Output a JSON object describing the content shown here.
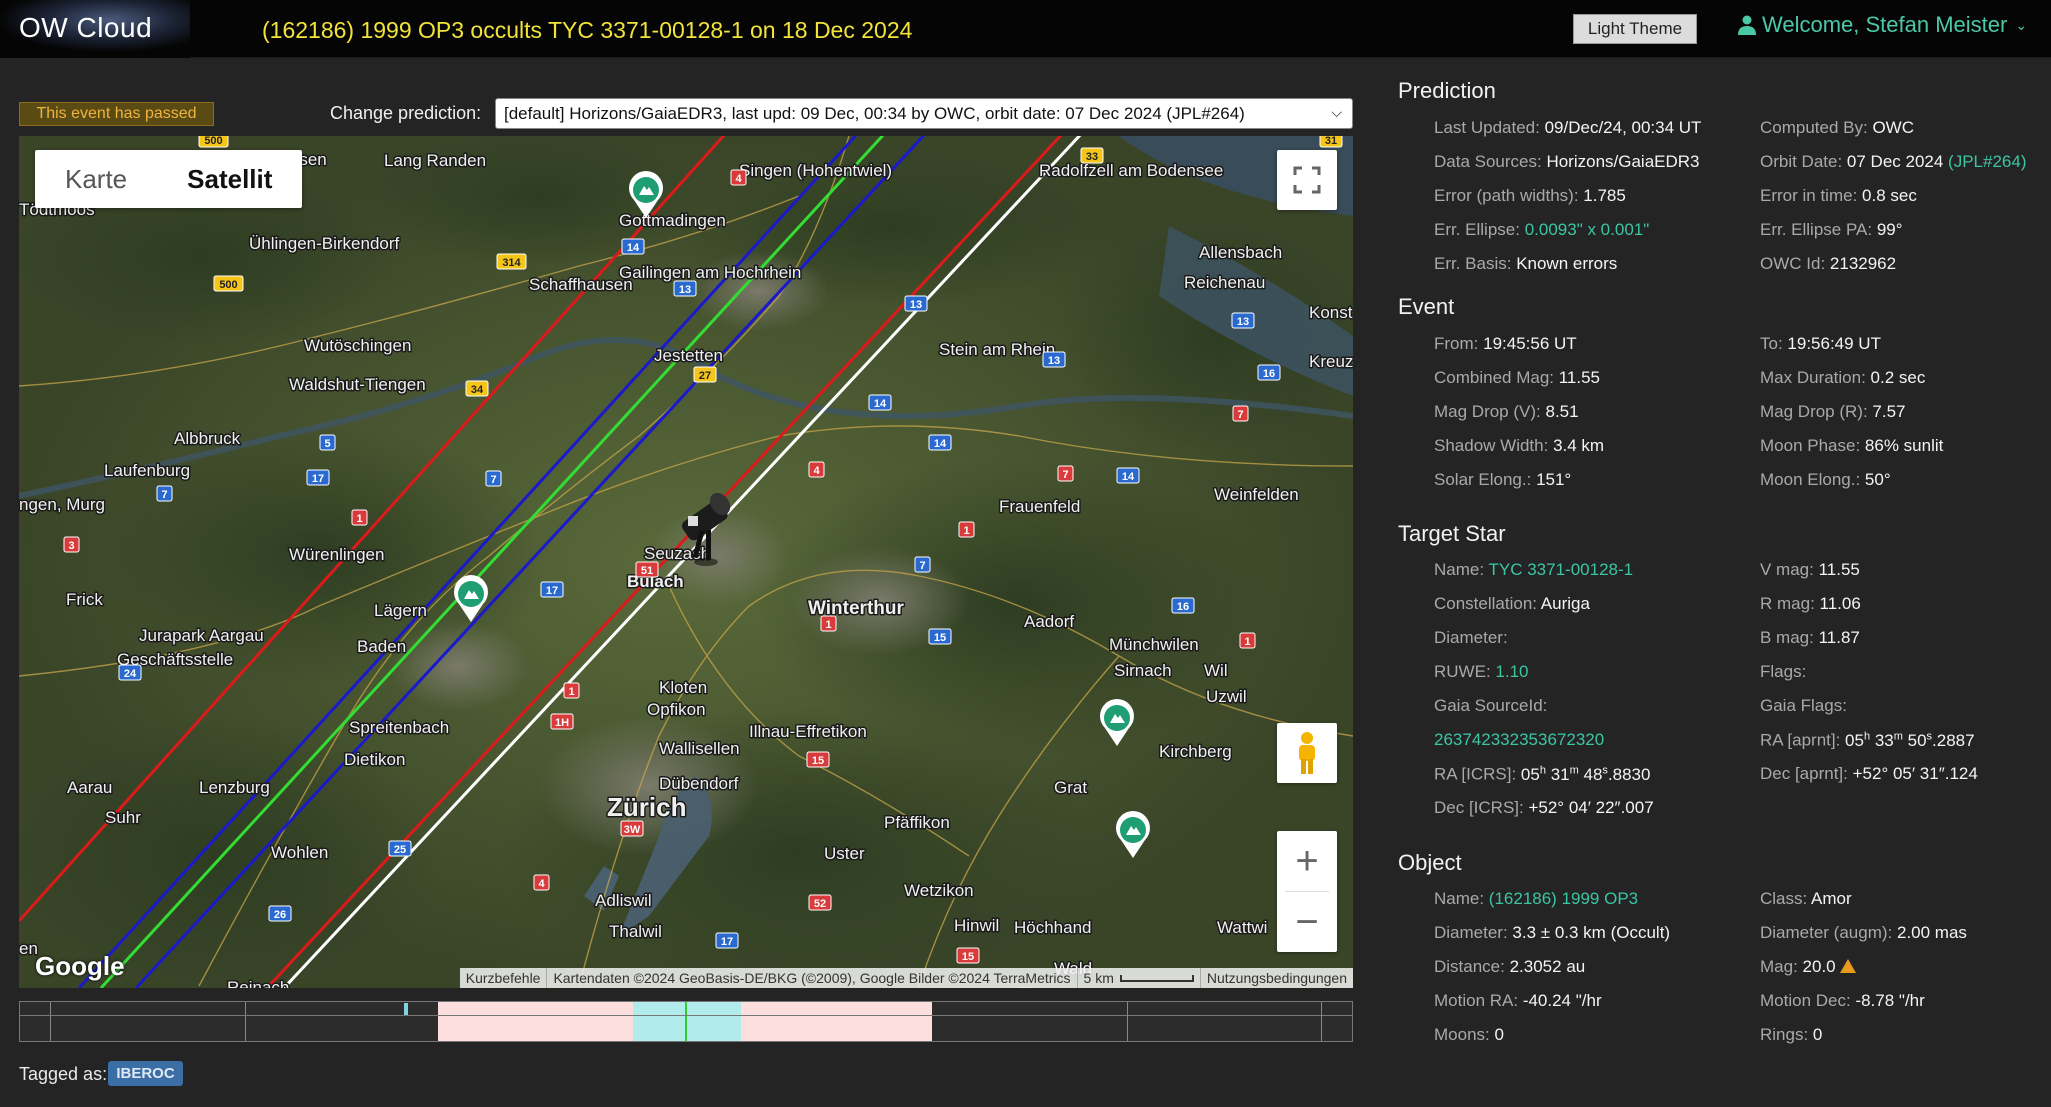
{
  "header": {
    "logo": "OW Cloud",
    "title": "(162186) 1999 OP3 occults TYC 3371-00128-1 on 18 Dec 2024",
    "theme_button": "Light Theme",
    "welcome": "Welcome, Stefan Meister"
  },
  "status_badge": "This event has passed",
  "change_prediction": {
    "label": "Change prediction:",
    "selected": "[default] Horizons/GaiaEDR3, last upd: 09 Dec, 00:34 by OWC, orbit date: 07 Dec 2024 (JPL#264)"
  },
  "map": {
    "type_map": "Karte",
    "type_satellite": "Satellit",
    "google": "Google",
    "attribution": {
      "shortcuts": "Kurzbefehle",
      "data": "Kartendaten ©2024 GeoBasis-DE/BKG (©2009), Google Bilder ©2024 TerraMetrics",
      "scale": "5 km",
      "terms": "Nutzungsbedingungen"
    },
    "places": [
      "Lang Randen",
      "Singen (Hohentwiel)",
      "Radolfzell am Bodensee",
      "Grafenhausen",
      "Tödtmoos",
      "Ühlingen-Birkendorf",
      "Gottmadingen",
      "Allensbach",
      "Reichenau",
      "Schaffhausen",
      "Gailingen am Hochrhein",
      "Konst",
      "Wutöschingen",
      "Jestetten",
      "Stein am Rhein",
      "Kreuzli",
      "Waldshut-Tiengen",
      "Albbruck",
      "Laufenburg",
      "ngen, Murg",
      "Frauenfeld",
      "Weinfelden",
      "Würenlingen",
      "Seuzach",
      "Frick",
      "Bülach",
      "Winterthur",
      "Aadorf",
      "Jurapark Aargau",
      "Geschäftsstelle",
      "Lägern",
      "Baden",
      "Münchwilen",
      "Sirnach",
      "Wil",
      "Kloten",
      "Opfikon",
      "Uzwil",
      "Spreitenbach",
      "Illnau-Effretikon",
      "Kirchberg",
      "Dietikon",
      "Wallisellen",
      "Dübendorf",
      "Aarau",
      "Lenzburg",
      "Grat",
      "Suhr",
      "Zürich",
      "Pfäffikon",
      "Wohlen",
      "Uster",
      "Wetzikon",
      "Adliswil",
      "Hinwil",
      "Höchhand",
      "Thalwil",
      "Wald",
      "Wattwi",
      "Reinach",
      "en"
    ],
    "road_numbers": [
      "500",
      "4",
      "31",
      "33",
      "14",
      "13",
      "314",
      "500",
      "13",
      "13",
      "13",
      "34",
      "27",
      "14",
      "16",
      "5",
      "7",
      "14",
      "7",
      "14",
      "17",
      "7",
      "4",
      "7",
      "1",
      "3",
      "51",
      "7",
      "16",
      "17",
      "1",
      "1",
      "15",
      "1",
      "24",
      "1H",
      "1",
      "15",
      "3W",
      "25",
      "4",
      "52",
      "26",
      "17",
      "15",
      "4"
    ]
  },
  "tagged": {
    "label": "Tagged as:",
    "tag": "IBEROC"
  },
  "prediction": {
    "title": "Prediction",
    "left": [
      {
        "label": "Last Updated:",
        "value": "09/Dec/24, 00:34 UT"
      },
      {
        "label": "Data Sources:",
        "value": "Horizons/GaiaEDR3"
      },
      {
        "label": "Error (path widths):",
        "value": "1.785"
      },
      {
        "label": "Err. Ellipse:",
        "value": "0.0093\" x 0.001\""
      },
      {
        "label": "Err. Basis:",
        "value": "Known errors"
      }
    ],
    "right": [
      {
        "label": "Computed By:",
        "value": "OWC"
      },
      {
        "label": "Orbit Date:",
        "value": "07 Dec 2024",
        "extra": "(JPL#264)"
      },
      {
        "label": "Error in time:",
        "value": "0.8 sec"
      },
      {
        "label": "Err. Ellipse PA:",
        "value": "99°"
      },
      {
        "label": "OWC Id:",
        "value": "2132962"
      }
    ]
  },
  "event": {
    "title": "Event",
    "left": [
      {
        "label": "From:",
        "value": "19:45:56 UT"
      },
      {
        "label": "Combined Mag:",
        "value": "11.55"
      },
      {
        "label": "Mag Drop (V):",
        "value": "8.51"
      },
      {
        "label": "Shadow Width:",
        "value": "3.4 km"
      },
      {
        "label": "Solar Elong.:",
        "value": "151°"
      }
    ],
    "right": [
      {
        "label": "To:",
        "value": "19:56:49 UT"
      },
      {
        "label": "Max Duration:",
        "value": "0.2 sec"
      },
      {
        "label": "Mag Drop (R):",
        "value": "7.57"
      },
      {
        "label": "Moon Phase:",
        "value": "86% sunlit"
      },
      {
        "label": "Moon Elong.:",
        "value": "50°"
      }
    ]
  },
  "target_star": {
    "title": "Target Star",
    "name_label": "Name:",
    "name": "TYC 3371-00128-1",
    "constellation_label": "Constellation:",
    "constellation": "Auriga",
    "diameter_label": "Diameter:",
    "ruwe_label": "RUWE:",
    "ruwe": "1.10",
    "gaia_label": "Gaia SourceId:",
    "gaia": "263742332353672320",
    "ra_icrs_label": "RA [ICRS]:",
    "ra_icrs": [
      "05",
      "h",
      " 31",
      "m",
      " 48",
      "s",
      ".8830"
    ],
    "dec_icrs_label": "Dec [ICRS]:",
    "dec_icrs": "+52° 04′ 22″.007",
    "vmag_label": "V mag:",
    "vmag": "11.55",
    "rmag_label": "R mag:",
    "rmag": "11.06",
    "bmag_label": "B mag:",
    "bmag": "11.87",
    "flags_label": "Flags:",
    "gaia_flags_label": "Gaia Flags:",
    "ra_aprnt_label": "RA [aprnt]:",
    "ra_aprnt": [
      "05",
      "h",
      " 33",
      "m",
      " 50",
      "s",
      ".2887"
    ],
    "dec_aprnt_label": "Dec [aprnt]:",
    "dec_aprnt": "+52° 05′ 31″.124"
  },
  "object": {
    "title": "Object",
    "left": [
      {
        "label": "Name:",
        "value": "(162186) 1999 OP3",
        "link": true
      },
      {
        "label": "Diameter:",
        "value": "3.3 ± 0.3 km",
        "extra": "(Occult)"
      },
      {
        "label": "Distance:",
        "value": "2.3052 au"
      },
      {
        "label": "Motion RA:",
        "value": "-40.24 \"/hr"
      },
      {
        "label": "Moons:",
        "value": "0"
      }
    ],
    "right": [
      {
        "label": "Class:",
        "value": "Amor"
      },
      {
        "label": "Diameter (augm):",
        "value": "2.00 mas"
      },
      {
        "label": "Mag:",
        "value": "20.0",
        "warn": true
      },
      {
        "label": "Motion Dec:",
        "value": "-8.78 \"/hr"
      },
      {
        "label": "Rings:",
        "value": "0"
      }
    ]
  },
  "colors": {
    "accent": "#3bc6a2",
    "title_yellow": "#f2e33a",
    "path_center": "#33dd33",
    "path_edge": "#1a1acc",
    "path_error": "#dd1a1a",
    "path_sigma": "#ffffff",
    "warn": "#e89a1e"
  }
}
